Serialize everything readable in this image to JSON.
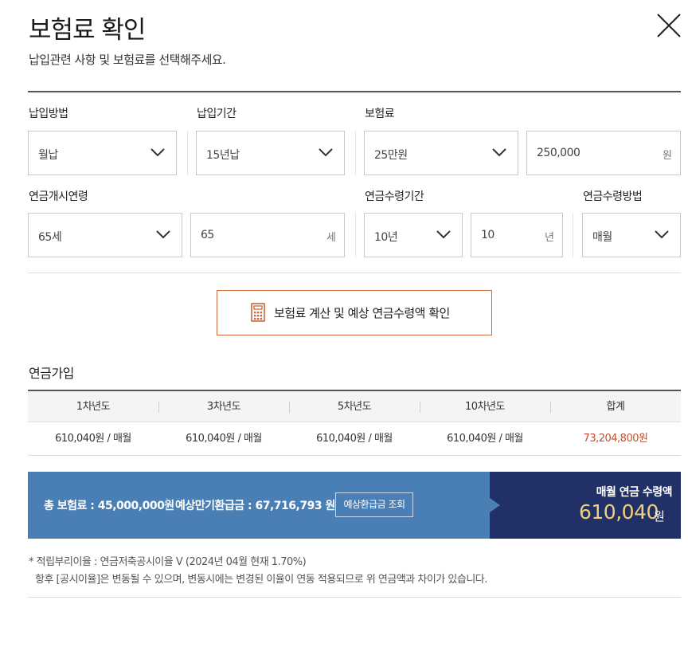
{
  "header": {
    "title": "보험료 확인",
    "subtitle": "납입관련 사항 및 보험료를 선택해주세요."
  },
  "form": {
    "payment_method": {
      "label": "납입방법",
      "value": "월납"
    },
    "payment_period": {
      "label": "납입기간",
      "value": "15년납"
    },
    "premium": {
      "label": "보험료",
      "select_value": "25만원",
      "input_value": "250,000",
      "unit": "원"
    },
    "start_age": {
      "label": "연금개시연령",
      "select_value": "65세",
      "input_value": "65",
      "unit": "세"
    },
    "receive_period": {
      "label": "연금수령기간",
      "select_value": "10년",
      "input_value": "10",
      "unit": "년"
    },
    "receive_method": {
      "label": "연금수령방법",
      "value": "매월"
    }
  },
  "calc_button": {
    "label": "보험료 계산 및 예상 연금수령액 확인",
    "icon": "calculator-icon",
    "border_color": "#c8693c"
  },
  "section": {
    "title": "연금가입",
    "headers": [
      "1차년도",
      "3차년도",
      "5차년도",
      "10차년도",
      "합계"
    ],
    "values": [
      "610,040원 / 매월",
      "610,040원 / 매월",
      "610,040원 / 매월",
      "610,040원 / 매월",
      "73,204,800원"
    ]
  },
  "summary": {
    "total_premium": "총 보험료 : 45,000,000원",
    "maturity_refund": "예상만기환급금 : 67,716,793 원",
    "refund_button": "예상환급금 조회",
    "monthly_label": "매월 연금 수령액",
    "monthly_amount": "610,040",
    "monthly_unit": "원",
    "colors": {
      "left_bg": "#4a7fb5",
      "right_bg": "#213167",
      "amount": "#f1d27a"
    }
  },
  "notes": {
    "line1": "* 적립부리이율 : 연금저축공시이율 V  (2024년 04월 현재 1.70%)",
    "line2": "항후 [공시이율]은 변동될 수 있으며, 변동시에는 변경된 이율이 연동 적용되므로 위 연금액과 차이가 있습니다."
  }
}
